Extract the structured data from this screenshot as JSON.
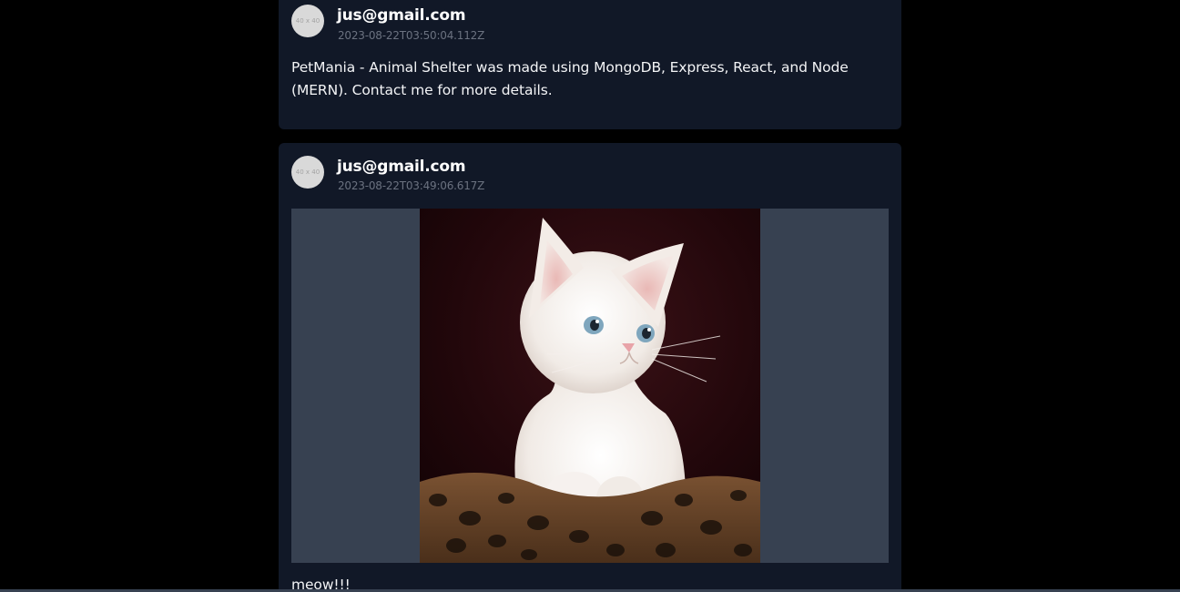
{
  "posts": [
    {
      "avatar_text": "40 x 40",
      "author": "jus@gmail.com",
      "timestamp": "2023-08-22T03:50:04.112Z",
      "text": "PetMania - Animal Shelter was made using MongoDB, Express, React, and Node (MERN). Contact me for more details."
    },
    {
      "avatar_text": "40 x 40",
      "author": "jus@gmail.com",
      "timestamp": "2023-08-22T03:49:06.617Z",
      "image_subject": "white kitten on leopard-print cushion",
      "text": "meow!!!"
    }
  ],
  "colors": {
    "page_background": "#000000",
    "card_background": "#111827",
    "image_frame": "#374151",
    "timestamp": "#6b7280"
  }
}
